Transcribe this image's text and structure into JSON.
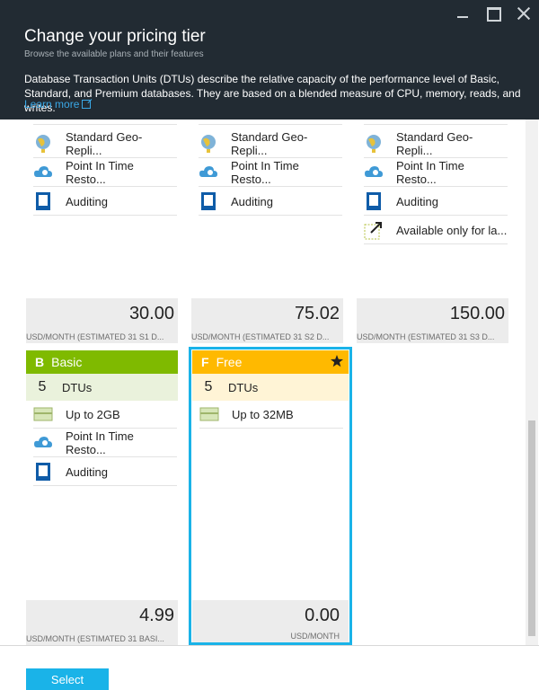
{
  "header": {
    "title": "Change your pricing tier",
    "subtitle": "Browse the available plans and their features",
    "description": "Database Transaction Units (DTUs) describe the relative capacity of the performance level of Basic, Standard, and Premium databases. They are based on a blended measure of CPU, memory, reads, and writes.",
    "learn_more": "Learn more"
  },
  "features": {
    "geo": "Standard Geo-Repli...",
    "pitr": "Point In Time Resto...",
    "auditing": "Auditing",
    "available": "Available only for la...",
    "up2gb": "Up to 2GB",
    "up32mb": "Up to 32MB",
    "dtus": "DTUs"
  },
  "cards": {
    "s1": {
      "price": "30.00",
      "label": "USD/MONTH (ESTIMATED 31 S1 D..."
    },
    "s2": {
      "price": "75.02",
      "label": "USD/MONTH (ESTIMATED 31 S2 D..."
    },
    "s3": {
      "price": "150.00",
      "label": "USD/MONTH (ESTIMATED 31 S3 D..."
    },
    "basic": {
      "letter": "B",
      "name": "Basic",
      "dtus": "5",
      "price": "4.99",
      "label": "USD/MONTH (ESTIMATED 31 BASI...",
      "color": "#7fba00"
    },
    "free": {
      "letter": "F",
      "name": "Free",
      "dtus": "5",
      "price": "0.00",
      "label": "USD/MONTH",
      "color": "#ffb900"
    }
  },
  "footer": {
    "select_label": "Select"
  },
  "colors": {
    "header_bg": "#222b33",
    "accent": "#1ab3e8",
    "selected_border": "#1ab3e8"
  }
}
